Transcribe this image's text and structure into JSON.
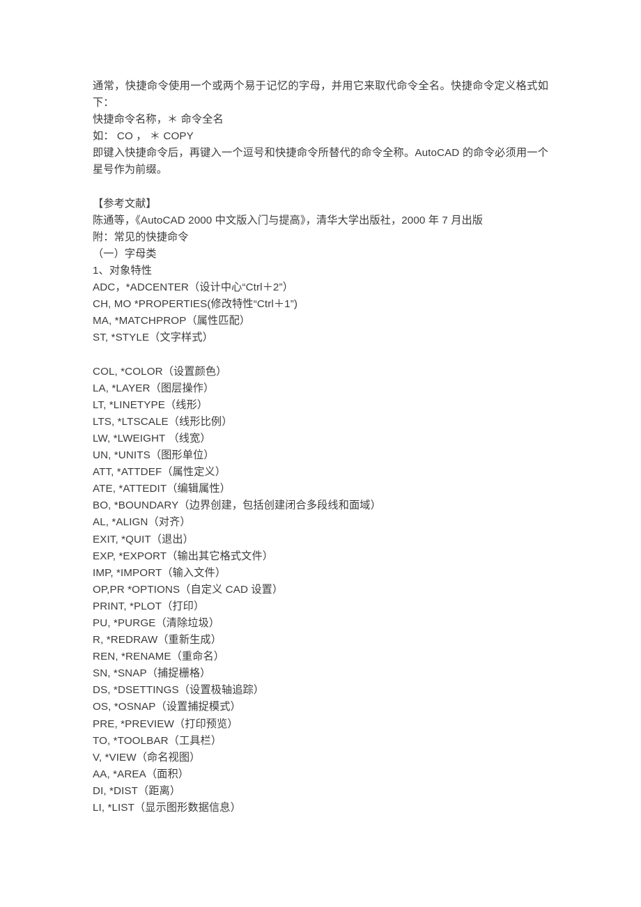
{
  "document": {
    "page_background": "#ffffff",
    "text_color": "#3c3c3c",
    "intro": {
      "paragraph_1": "通常，快捷命令使用一个或两个易于记忆的字母，并用它来取代命令全名。快捷命令定义格式如下：",
      "line_format": "快捷命令名称，＊ 命令全名",
      "line_example": "如： CO ， ＊ COPY",
      "paragraph_2": "即键入快捷命令后，再键入一个逗号和快捷命令所替代的命令全称。AutoCAD 的命令必须用一个星号作为前缀。"
    },
    "references": {
      "heading": "【参考文献】",
      "entry": "陈通等，《AutoCAD 2000 中文版入门与提高》，清华大学出版社，2000 年 7 月出版",
      "appendix": "附：常见的快捷命令",
      "section": "（一）字母类",
      "subsection": "1、对象特性"
    },
    "commands_group_1": [
      "ADC，*ADCENTER（设计中心“Ctrl＋2”）",
      "CH, MO *PROPERTIES(修改特性“Ctrl＋1”)",
      "MA, *MATCHPROP（属性匹配）",
      "ST, *STYLE（文字样式）"
    ],
    "commands_group_2": [
      "COL, *COLOR（设置颜色）",
      "LA, *LAYER（图层操作）",
      "LT, *LINETYPE（线形）",
      "LTS, *LTSCALE（线形比例）",
      "LW, *LWEIGHT （线宽）",
      "UN, *UNITS（图形单位）",
      "ATT, *ATTDEF（属性定义）",
      "ATE, *ATTEDIT（编辑属性）",
      "BO, *BOUNDARY（边界创建，包括创建闭合多段线和面域）",
      "AL, *ALIGN（对齐）",
      "EXIT, *QUIT（退出）",
      "EXP, *EXPORT（输出其它格式文件）",
      "IMP, *IMPORT（输入文件）",
      "OP,PR *OPTIONS（自定义 CAD 设置）",
      "PRINT, *PLOT（打印）",
      "PU, *PURGE（清除垃圾）",
      "R, *REDRAW（重新生成）",
      "REN, *RENAME（重命名）",
      "SN, *SNAP（捕捉栅格）",
      "DS, *DSETTINGS（设置极轴追踪）",
      "OS, *OSNAP（设置捕捉模式）",
      "PRE, *PREVIEW（打印预览）",
      "TO, *TOOLBAR（工具栏）",
      "V, *VIEW（命名视图）",
      "AA, *AREA（面积）",
      "DI, *DIST（距离）",
      "LI, *LIST（显示图形数据信息）"
    ]
  }
}
